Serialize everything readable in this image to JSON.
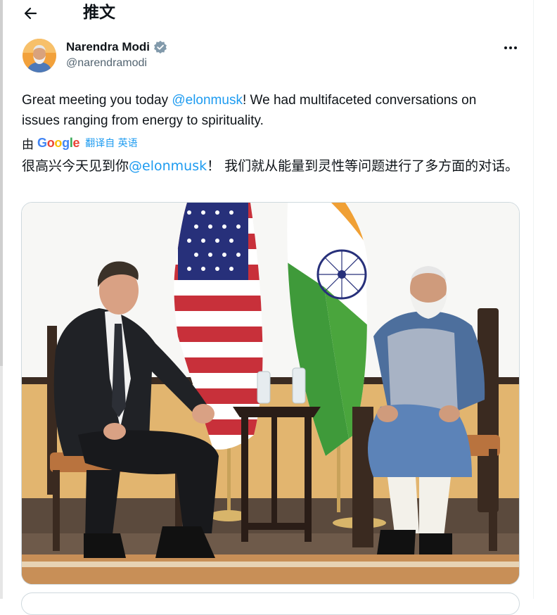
{
  "header": {
    "title": "推文",
    "back_icon": "arrow-left-icon"
  },
  "tweet": {
    "author_name": "Narendra Modi",
    "handle": "@narendramodi",
    "verified_icon": "verified-badge-icon",
    "more_icon": "more-horizontal-icon",
    "text_before_mention": "Great meeting you today ",
    "mention": "@elonmusk",
    "text_after_mention": "! We had multifaceted conversations on issues ranging from energy to spirituality.",
    "translation": {
      "by": "由",
      "provider": "Google",
      "link": "翻译自 英语"
    },
    "translated_before_mention": "很高兴今天见到你",
    "translated_mention": "@elonmusk",
    "translated_after_mention": "！ 我们就从能量到灵性等问题进行了多方面的对话。"
  },
  "colors": {
    "mention_blue": "#1d9bf0",
    "secondary_text": "#536471",
    "verified_blue": "#1d9bf0"
  }
}
